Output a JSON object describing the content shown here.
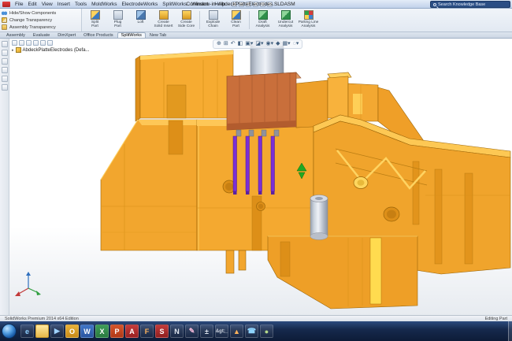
{
  "titlebar": {
    "menus": [
      "File",
      "Edit",
      "View",
      "Insert",
      "Tools",
      "MoldWorks",
      "ElectrodeWorks",
      "SplitWorks",
      "Window",
      "Help"
    ],
    "title": "ConInsert -in- AbdeckPlatteElectrodes.SLDASM",
    "search": "Search Knowledge Base"
  },
  "command_panel": {
    "items": [
      "Hide/Show Components",
      "Change Transparency",
      "Assembly Transparency"
    ]
  },
  "ribbon": {
    "buttons": [
      "Split\nPart",
      "Plug\nPart",
      "Loft",
      "Create\nSolid Insert",
      "Create\nSide Core",
      "Explode\nChain",
      "Clean\nPart",
      "Draft\nAnalysis",
      "Undercut\nAnalysis",
      "Parting Line\nAnalysis"
    ]
  },
  "tabs": {
    "items": [
      {
        "label": "Assembly",
        "active": false
      },
      {
        "label": "Evaluate",
        "active": false
      },
      {
        "label": "DimXpert",
        "active": false
      },
      {
        "label": "Office Products",
        "active": false
      },
      {
        "label": "SplitWorks",
        "active": true
      },
      {
        "label": "New Tab",
        "active": false
      }
    ]
  },
  "feature_tree": {
    "root": "AbdeckPlatteElectrodes (Defa..."
  },
  "hud": {
    "icons": [
      {
        "name": "zoom-fit-icon",
        "glyph": "⊕"
      },
      {
        "name": "zoom-area-icon",
        "glyph": "⊞"
      },
      {
        "name": "previous-view-icon",
        "glyph": "↶"
      },
      {
        "name": "section-view-icon",
        "glyph": "◧"
      },
      {
        "name": "view-orientation-icon",
        "glyph": "▣▾"
      },
      {
        "name": "display-style-icon",
        "glyph": "◪▾"
      },
      {
        "name": "hide-show-items-icon",
        "glyph": "◉▾"
      },
      {
        "name": "edit-appearance-icon",
        "glyph": "◆"
      },
      {
        "name": "apply-scene-icon",
        "glyph": "▦▾"
      },
      {
        "name": "view-settings-icon",
        "glyph": "◌▾"
      }
    ]
  },
  "scene": {
    "parts": [
      "mold-plate",
      "mold-upper-left-block",
      "copper-insert",
      "electrode-pins",
      "holder-cylinder",
      "support-boss",
      "mate-marker",
      "origin-triad"
    ],
    "colors": {
      "mold_orange": "#f2a62e",
      "mold_highlight": "#ffd061",
      "mold_shadow": "#dd8f18",
      "copper_insert": "#c96f3b",
      "electrode_purple": "#7b2fd6",
      "steel_gray": "#cfd4dd",
      "marker_green": "#22a822"
    }
  },
  "statusbar": {
    "left": "SolidWorks Premium 2014 x64 Edition",
    "right": "Editing Part"
  },
  "taskbar": {
    "items": [
      {
        "name": "internet-explorer",
        "glyph": "e"
      },
      {
        "name": "windows-explorer",
        "glyph": ""
      },
      {
        "name": "media-player",
        "glyph": "▶"
      },
      {
        "name": "outlook",
        "glyph": "O"
      },
      {
        "name": "word",
        "glyph": "W"
      },
      {
        "name": "excel",
        "glyph": "X"
      },
      {
        "name": "powerpoint",
        "glyph": "P"
      },
      {
        "name": "acrobat-reader",
        "glyph": "A"
      },
      {
        "name": "firefox",
        "glyph": "F"
      },
      {
        "name": "solidworks",
        "glyph": "S"
      },
      {
        "name": "notepad",
        "glyph": "N"
      },
      {
        "name": "paint",
        "glyph": "✎"
      },
      {
        "name": "calculator",
        "glyph": "±"
      },
      {
        "name": "command-prompt",
        "glyph": "&gt;_"
      },
      {
        "name": "vlc",
        "glyph": "▲"
      },
      {
        "name": "skype",
        "glyph": "☎"
      },
      {
        "name": "chrome",
        "glyph": "●"
      }
    ]
  }
}
